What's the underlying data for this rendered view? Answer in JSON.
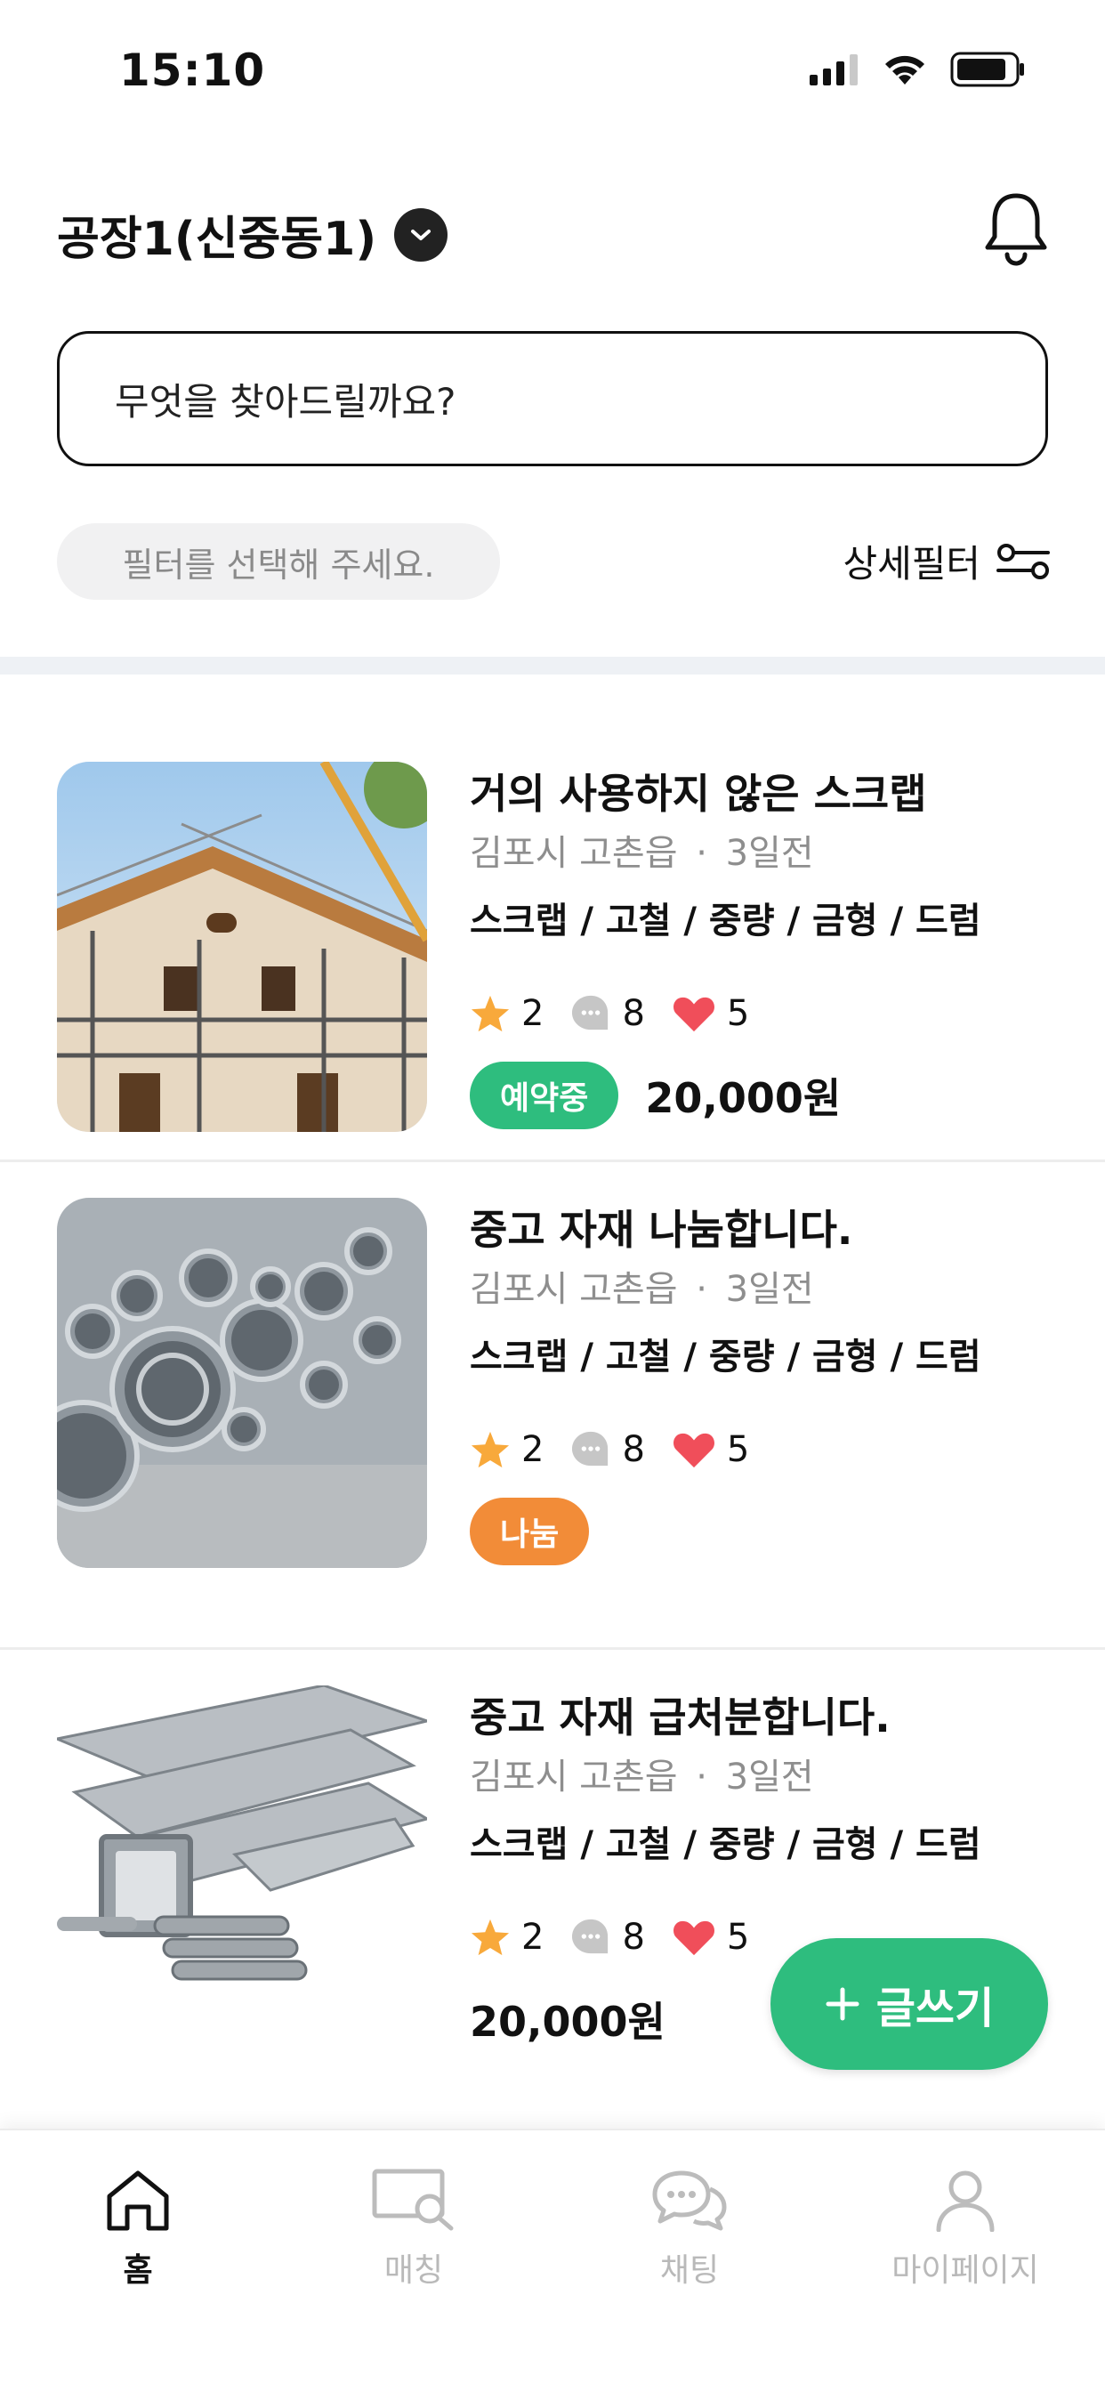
{
  "status_bar": {
    "time": "15:10"
  },
  "header": {
    "location": "공장1(신중동1)"
  },
  "search": {
    "placeholder": "무엇을 찾아드릴까요?"
  },
  "filter": {
    "pill_text": "필터를 선택해 주세요.",
    "detail_label": "상세필터"
  },
  "colors": {
    "accent": "#2ebd7e",
    "share": "#f28c38",
    "star": "#f8a93b",
    "heart": "#f04e5a"
  },
  "listings": [
    {
      "title": "거의 사용하지 않은 스크랩",
      "location": "김포시 고촌읍",
      "sep": "·",
      "time": "3일전",
      "tags": "스크랩 / 고철 / 중량 / 금형 / 드럼",
      "stars": "2",
      "comments": "8",
      "likes": "5",
      "badge": "예약중",
      "price": "20,000원"
    },
    {
      "title": "중고 자재 나눔합니다.",
      "location": "김포시 고촌읍",
      "sep": "·",
      "time": "3일전",
      "tags": "스크랩 / 고철 / 중량 / 금형 / 드럼",
      "stars": "2",
      "comments": "8",
      "likes": "5",
      "badge": "나눔"
    },
    {
      "title": "중고 자재 급처분합니다.",
      "location": "김포시 고촌읍",
      "sep": "·",
      "time": "3일전",
      "tags": "스크랩 / 고철 / 중량 / 금형 / 드럼",
      "stars": "2",
      "comments": "8",
      "likes": "5",
      "price": "20,000원"
    }
  ],
  "fab": {
    "label": "글쓰기"
  },
  "tabbar": {
    "items": [
      {
        "label": "홈"
      },
      {
        "label": "매칭"
      },
      {
        "label": "채팅"
      },
      {
        "label": "마이페이지"
      }
    ]
  }
}
